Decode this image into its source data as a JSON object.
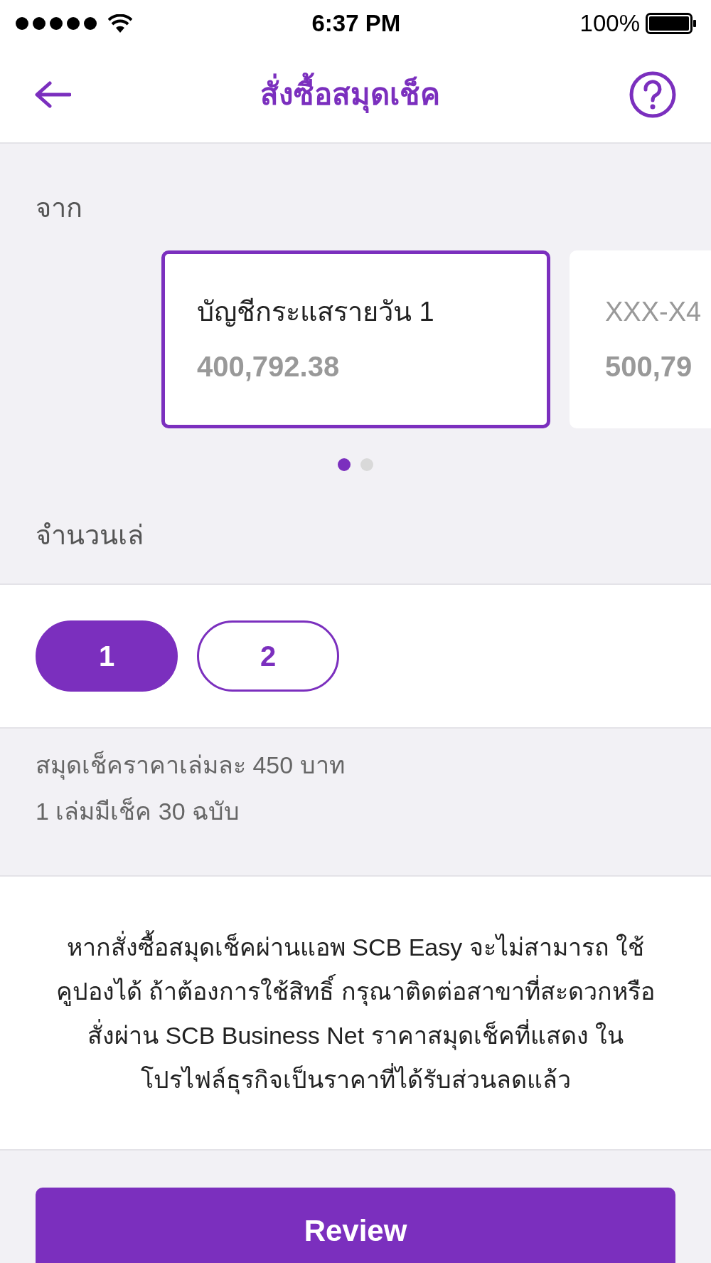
{
  "status_bar": {
    "time": "6:37 PM",
    "battery": "100%"
  },
  "header": {
    "title": "สั่งซื้อสมุดเช็ค"
  },
  "from": {
    "label": "จาก",
    "accounts": [
      {
        "name": "บัญชีกระแสรายวัน 1",
        "balance": "400,792.38",
        "selected": true
      },
      {
        "name": "XXX-X4",
        "balance": "500,79",
        "selected": false
      }
    ],
    "pages": [
      {
        "selected": true
      },
      {
        "selected": false
      }
    ]
  },
  "quantity": {
    "label": "จำนวนเล่",
    "options": [
      {
        "label": "1",
        "selected": true
      },
      {
        "label": "2",
        "selected": false
      }
    ]
  },
  "info": [
    "สมุดเช็คราคาเล่มละ 450 บาท",
    "1 เล่มมีเช็ค 30 ฉบับ"
  ],
  "notice": "หากสั่งซื้อสมุดเช็คผ่านแอพ SCB Easy จะไม่สามารถ ใช้คูปองได้ ถ้าต้องการใช้สิทธิ์ กรุณาติดต่อสาขาที่สะดวกหรือสั่งผ่าน SCB Business Net ราคาสมุดเช็คที่แสดง ในโปรไฟล์ธุรกิจเป็นราคาที่ได้รับส่วนลดแล้ว",
  "review_button": "Review"
}
